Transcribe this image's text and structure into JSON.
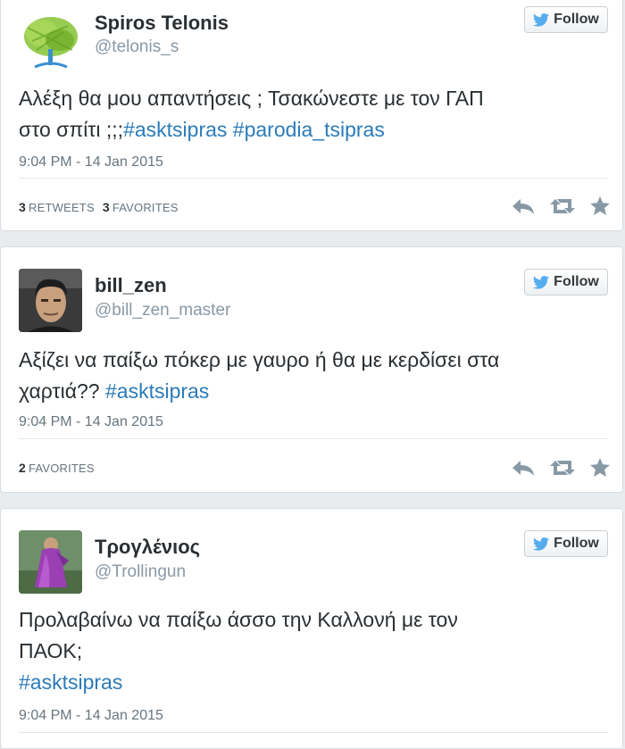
{
  "tweets": [
    {
      "name": "Spiros Telonis",
      "handle": "@telonis_s",
      "follow_label": "Follow",
      "text_plain": "Αλέξη θα μου απαντήσεις ; Τσακώνεστε με τον ΓΑΠ\nστο σπίτι ;;;",
      "hashtags": [
        "#asktsipras",
        "#parodia_tsipras"
      ],
      "timestamp": "9:04 PM - 14 Jan 2015",
      "retweets_count": "3",
      "retweets_label": "RETWEETS",
      "favorites_count": "3",
      "favorites_label": "FAVORITES"
    },
    {
      "name": "bill_zen",
      "handle": "@bill_zen_master",
      "follow_label": "Follow",
      "text_plain": "Αξίζει να παίξω πόκερ με γαυρο ή θα με κερδίσει στα\nχαρτιά?? ",
      "hashtags": [
        "#asktsipras"
      ],
      "timestamp": "9:04 PM - 14 Jan 2015",
      "favorites_count": "2",
      "favorites_label": "FAVORITES"
    },
    {
      "name": "Τρογλένιος",
      "handle": "@Trollingun",
      "follow_label": "Follow",
      "text_plain": "Προλαβαίνω να παίξω άσσο την Καλλονή με τον\nΠΑΟΚ;\n ",
      "hashtags": [
        "#asktsipras"
      ],
      "timestamp": "9:04 PM - 14 Jan 2015"
    }
  ],
  "icons": {
    "follow": "twitter-bird-icon",
    "reply": "reply-icon",
    "retweet": "retweet-icon",
    "favorite": "star-icon"
  },
  "colors": {
    "hashtag": "#2b7bb9",
    "name": "#292f33",
    "secondary": "#8899a6",
    "bird": "#55acee",
    "action_icon": "#8899a6"
  }
}
